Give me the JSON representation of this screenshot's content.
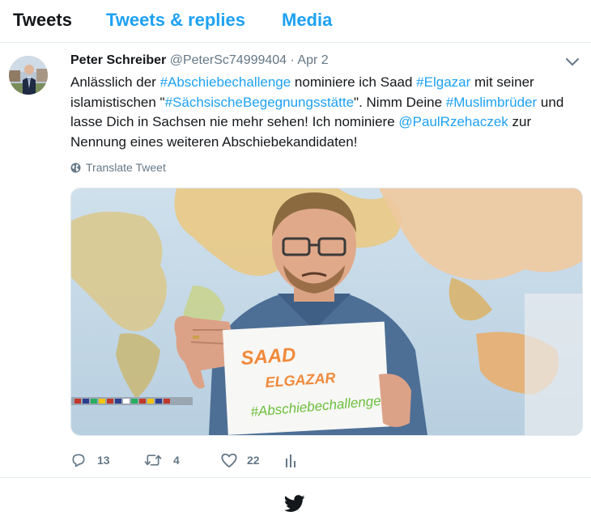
{
  "tabs": [
    {
      "label": "Tweets"
    },
    {
      "label": "Tweets & replies"
    },
    {
      "label": "Media"
    }
  ],
  "tweet": {
    "name": "Peter Schreiber",
    "handle": "@PeterSc74999404",
    "separator": "·",
    "date": "Apr 2",
    "text": {
      "p1": "Anlässlich der ",
      "h1": "#Abschiebechallenge",
      "p2": "  nominiere ich Saad ",
      "h2": "#Elgazar",
      "p3": " mit seiner islamistischen  \"",
      "h3": "#SächsischeBegegnungsstätte",
      "p4": "\". Nimm Deine ",
      "h4": "#Muslimbrüder",
      "p5": " und lasse Dich in Sachsen nie mehr sehen! Ich nominiere ",
      "h5": "@PaulRzehaczek",
      "p6": " zur Nennung eines weiteren Abschiebekandidaten!"
    },
    "translate_label": "Translate Tweet",
    "media": {
      "sign_line1": "SAAD",
      "sign_line2": "ELGAZAR",
      "sign_line3": "#Abschiebechallenge"
    },
    "actions": {
      "replies": "13",
      "retweets": "4",
      "likes": "22"
    }
  },
  "colors": {
    "accent": "#1da1f2",
    "secondary_text": "#657786",
    "border": "#e6ecf0"
  },
  "icons": [
    "globe-icon",
    "chevron-down-icon",
    "reply-icon",
    "retweet-icon",
    "like-icon",
    "analytics-icon",
    "twitter-bird-icon"
  ]
}
